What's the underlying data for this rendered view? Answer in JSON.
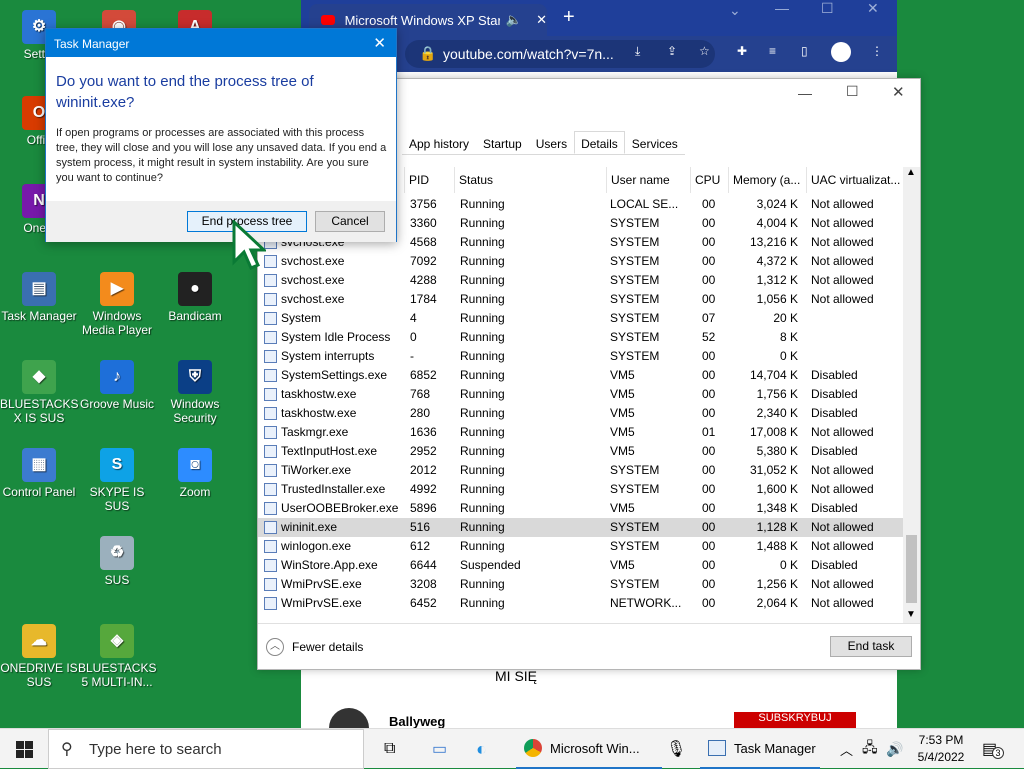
{
  "desktop": {
    "icons": [
      {
        "label": "Settin",
        "glyph": "⚙",
        "color": "#2a74d4"
      },
      {
        "label": "",
        "glyph": "◉",
        "color": "#d34a3a"
      },
      {
        "label": "",
        "glyph": "A",
        "color": "#c72c2c"
      },
      {
        "label": "Offic",
        "glyph": "O",
        "color": "#d83b01"
      },
      {
        "label": "OneN",
        "glyph": "N",
        "color": "#7719aa"
      },
      {
        "label": "Task Manager",
        "glyph": "▤",
        "color": "#3a6fb0"
      },
      {
        "label": "Windows Media Player",
        "glyph": "▶",
        "color": "#f38b1c"
      },
      {
        "label": "Bandicam",
        "glyph": "●",
        "color": "#222222"
      },
      {
        "label": "BLUESTACKS X IS SUS",
        "glyph": "◆",
        "color": "#3fa34d"
      },
      {
        "label": "Groove Music",
        "glyph": "♪",
        "color": "#1e6fd9"
      },
      {
        "label": "Windows Security",
        "glyph": "⛨",
        "color": "#0b3f86"
      },
      {
        "label": "Control Panel",
        "glyph": "▦",
        "color": "#3c7bd0"
      },
      {
        "label": "SKYPE IS SUS",
        "glyph": "S",
        "color": "#0ea2e6"
      },
      {
        "label": "Zoom",
        "glyph": "◙",
        "color": "#2d8cff"
      },
      {
        "label": "SUS",
        "glyph": "♻",
        "color": "#9bb0bd"
      },
      {
        "label": "ONEDRIVE IS SUS",
        "glyph": "☁",
        "color": "#e7b82b"
      },
      {
        "label": "BLUESTACKS 5 MULTI-IN...",
        "glyph": "◈",
        "color": "#56a83c"
      },
      {
        "label": "Edge",
        "glyph": "",
        "color": "#1a8a3e"
      }
    ]
  },
  "browser": {
    "tab_title": "Microsoft Windows XP Startu",
    "url": "youtube.com/watch?v=7n...",
    "content_text": "MI SIĘ",
    "channel": "Ballyweg",
    "subscribe": "SUBSKRYBUJ"
  },
  "task_manager": {
    "tabs": [
      "App history",
      "Startup",
      "Users",
      "Details",
      "Services"
    ],
    "active_tab": "Details",
    "columns": [
      "PID",
      "Status",
      "User name",
      "CPU",
      "Memory (a...",
      "UAC virtualizat..."
    ],
    "rows": [
      {
        "name": "",
        "pid": "3756",
        "status": "Running",
        "user": "LOCAL SE...",
        "cpu": "00",
        "mem": "3,024 K",
        "uac": "Not allowed"
      },
      {
        "name": "",
        "pid": "3360",
        "status": "Running",
        "user": "SYSTEM",
        "cpu": "00",
        "mem": "4,004 K",
        "uac": "Not allowed"
      },
      {
        "name": "svchost.exe",
        "pid": "4568",
        "status": "Running",
        "user": "SYSTEM",
        "cpu": "00",
        "mem": "13,216 K",
        "uac": "Not allowed"
      },
      {
        "name": "svchost.exe",
        "pid": "7092",
        "status": "Running",
        "user": "SYSTEM",
        "cpu": "00",
        "mem": "4,372 K",
        "uac": "Not allowed"
      },
      {
        "name": "svchost.exe",
        "pid": "4288",
        "status": "Running",
        "user": "SYSTEM",
        "cpu": "00",
        "mem": "1,312 K",
        "uac": "Not allowed"
      },
      {
        "name": "svchost.exe",
        "pid": "1784",
        "status": "Running",
        "user": "SYSTEM",
        "cpu": "00",
        "mem": "1,056 K",
        "uac": "Not allowed"
      },
      {
        "name": "System",
        "pid": "4",
        "status": "Running",
        "user": "SYSTEM",
        "cpu": "07",
        "mem": "20 K",
        "uac": ""
      },
      {
        "name": "System Idle Process",
        "pid": "0",
        "status": "Running",
        "user": "SYSTEM",
        "cpu": "52",
        "mem": "8 K",
        "uac": ""
      },
      {
        "name": "System interrupts",
        "pid": "-",
        "status": "Running",
        "user": "SYSTEM",
        "cpu": "00",
        "mem": "0 K",
        "uac": ""
      },
      {
        "name": "SystemSettings.exe",
        "pid": "6852",
        "status": "Running",
        "user": "VM5",
        "cpu": "00",
        "mem": "14,704 K",
        "uac": "Disabled"
      },
      {
        "name": "taskhostw.exe",
        "pid": "768",
        "status": "Running",
        "user": "VM5",
        "cpu": "00",
        "mem": "1,756 K",
        "uac": "Disabled"
      },
      {
        "name": "taskhostw.exe",
        "pid": "280",
        "status": "Running",
        "user": "VM5",
        "cpu": "00",
        "mem": "2,340 K",
        "uac": "Disabled"
      },
      {
        "name": "Taskmgr.exe",
        "pid": "1636",
        "status": "Running",
        "user": "VM5",
        "cpu": "01",
        "mem": "17,008 K",
        "uac": "Not allowed"
      },
      {
        "name": "TextInputHost.exe",
        "pid": "2952",
        "status": "Running",
        "user": "VM5",
        "cpu": "00",
        "mem": "5,380 K",
        "uac": "Disabled"
      },
      {
        "name": "TiWorker.exe",
        "pid": "2012",
        "status": "Running",
        "user": "SYSTEM",
        "cpu": "00",
        "mem": "31,052 K",
        "uac": "Not allowed"
      },
      {
        "name": "TrustedInstaller.exe",
        "pid": "4992",
        "status": "Running",
        "user": "SYSTEM",
        "cpu": "00",
        "mem": "1,600 K",
        "uac": "Not allowed"
      },
      {
        "name": "UserOOBEBroker.exe",
        "pid": "5896",
        "status": "Running",
        "user": "VM5",
        "cpu": "00",
        "mem": "1,348 K",
        "uac": "Disabled"
      },
      {
        "name": "wininit.exe",
        "pid": "516",
        "status": "Running",
        "user": "SYSTEM",
        "cpu": "00",
        "mem": "1,128 K",
        "uac": "Not allowed",
        "selected": true
      },
      {
        "name": "winlogon.exe",
        "pid": "612",
        "status": "Running",
        "user": "SYSTEM",
        "cpu": "00",
        "mem": "1,488 K",
        "uac": "Not allowed"
      },
      {
        "name": "WinStore.App.exe",
        "pid": "6644",
        "status": "Suspended",
        "user": "VM5",
        "cpu": "00",
        "mem": "0 K",
        "uac": "Disabled"
      },
      {
        "name": "WmiPrvSE.exe",
        "pid": "3208",
        "status": "Running",
        "user": "SYSTEM",
        "cpu": "00",
        "mem": "1,256 K",
        "uac": "Not allowed"
      },
      {
        "name": "WmiPrvSE.exe",
        "pid": "6452",
        "status": "Running",
        "user": "NETWORK...",
        "cpu": "00",
        "mem": "2,064 K",
        "uac": "Not allowed"
      }
    ],
    "fewer_details": "Fewer details",
    "end_task": "End task"
  },
  "dialog": {
    "title": "Task Manager",
    "heading": "Do you want to end the process tree of wininit.exe?",
    "body": "If open programs or processes are associated with this process tree, they will close and you will lose any unsaved data. If you end a system process, it might result in system instability. Are you sure you want to continue?",
    "confirm": "End process tree",
    "cancel": "Cancel"
  },
  "taskbar": {
    "search_placeholder": "Type here to search",
    "chrome_label": "Microsoft Win...",
    "taskmgr_label": "Task Manager",
    "time": "7:53 PM",
    "date": "5/4/2022",
    "notifications": "3"
  }
}
